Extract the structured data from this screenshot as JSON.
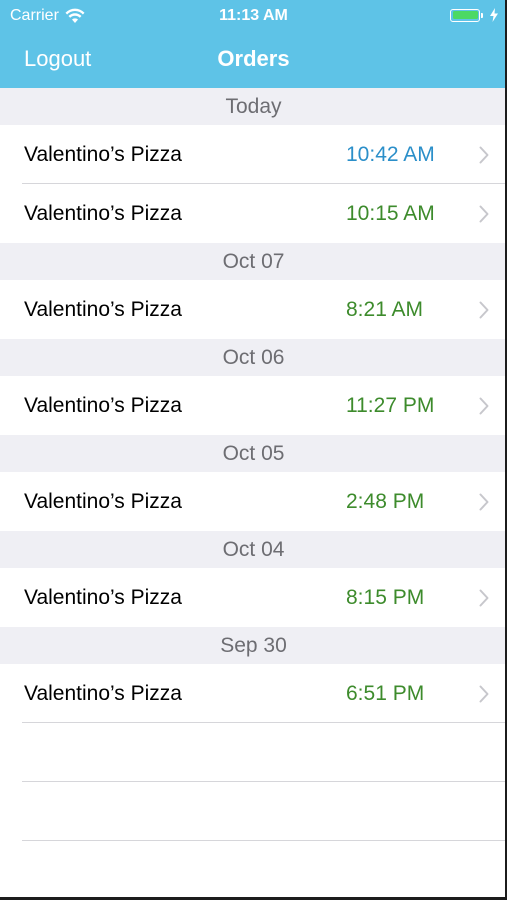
{
  "status_bar": {
    "carrier": "Carrier",
    "time": "11:13 AM",
    "battery_color": "#4cd964",
    "icons": [
      "wifi-icon",
      "battery-icon",
      "bolt-icon"
    ]
  },
  "nav": {
    "logout_label": "Logout",
    "title": "Orders",
    "background": "#5ec3e7"
  },
  "sections": [
    {
      "header": "Today",
      "rows": [
        {
          "name": "Valentino’s Pizza",
          "time": "10:42 AM",
          "time_color": "blue"
        },
        {
          "name": "Valentino’s Pizza",
          "time": "10:15 AM",
          "time_color": "green"
        }
      ]
    },
    {
      "header": "Oct 07",
      "rows": [
        {
          "name": "Valentino’s Pizza",
          "time": "8:21 AM",
          "time_color": "green"
        }
      ]
    },
    {
      "header": "Oct 06",
      "rows": [
        {
          "name": "Valentino’s Pizza",
          "time": "11:27 PM",
          "time_color": "green"
        }
      ]
    },
    {
      "header": "Oct 05",
      "rows": [
        {
          "name": "Valentino’s Pizza",
          "time": "2:48 PM",
          "time_color": "green"
        }
      ]
    },
    {
      "header": "Oct 04",
      "rows": [
        {
          "name": "Valentino’s Pizza",
          "time": "8:15 PM",
          "time_color": "green"
        }
      ]
    },
    {
      "header": "Sep 30",
      "rows": [
        {
          "name": "Valentino’s Pizza",
          "time": "6:51 PM",
          "time_color": "green"
        }
      ]
    }
  ],
  "colors": {
    "time_blue": "#2b8fc9",
    "time_green": "#3d8b2c",
    "section_bg": "#efeff4"
  }
}
